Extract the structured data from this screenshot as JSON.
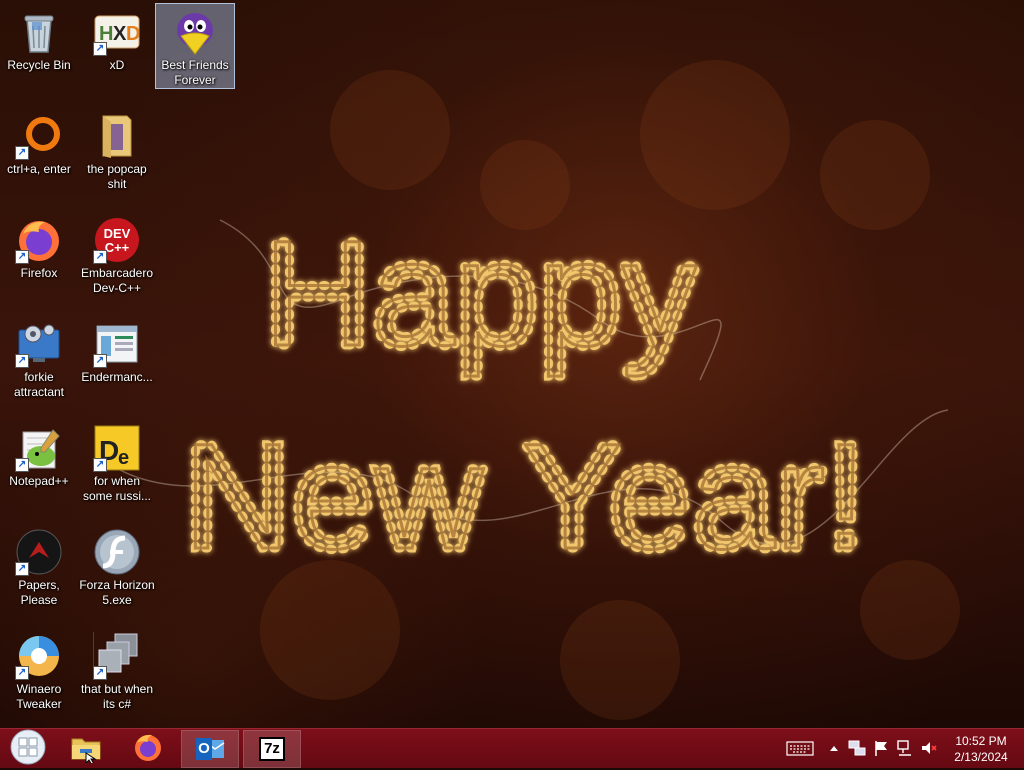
{
  "desktop": {
    "greeting": {
      "line1": "Happy",
      "line2": "New Year!"
    },
    "icons": [
      {
        "label": "Recycle Bin",
        "shortcut": false,
        "selected": false,
        "icon": "recycle-bin-icon"
      },
      {
        "label": "xD",
        "shortcut": true,
        "selected": false,
        "icon": "hxd-hex-editor-icon"
      },
      {
        "label": "Best Friends Forever",
        "shortcut": false,
        "selected": true,
        "icon": "purple-bird-icon"
      },
      {
        "label": "ctrl+a, enter",
        "shortcut": true,
        "selected": false,
        "icon": "orange-ring-icon"
      },
      {
        "label": "the popcap shit",
        "shortcut": false,
        "selected": false,
        "icon": "folder-icon"
      },
      {
        "label": "Firefox",
        "shortcut": true,
        "selected": false,
        "icon": "firefox-icon"
      },
      {
        "label": "Embarcadero Dev-C++",
        "shortcut": true,
        "selected": false,
        "icon": "dev-cpp-icon"
      },
      {
        "label": "forkie attractant",
        "shortcut": true,
        "selected": false,
        "icon": "settings-monitor-icon"
      },
      {
        "label": "Endermanc...",
        "shortcut": true,
        "selected": false,
        "icon": "window-app-icon"
      },
      {
        "label": "Notepad++",
        "shortcut": true,
        "selected": false,
        "icon": "notepad-plus-plus-icon"
      },
      {
        "label": "for when some russi...",
        "shortcut": true,
        "selected": false,
        "icon": "de-app-icon"
      },
      {
        "label": "Papers, Please",
        "shortcut": true,
        "selected": false,
        "icon": "papers-please-icon"
      },
      {
        "label": "Forza Horizon 5.exe",
        "shortcut": false,
        "selected": false,
        "icon": "flash-player-icon"
      },
      {
        "label": "Winaero Tweaker",
        "shortcut": true,
        "selected": false,
        "icon": "winaero-tweaker-icon"
      },
      {
        "label": "that but when its c#",
        "shortcut": true,
        "selected": false,
        "icon": "stacked-windows-icon"
      }
    ]
  },
  "taskbar": {
    "buttons": [
      {
        "name": "start-button",
        "icon": "windows-logo-icon",
        "active": false
      },
      {
        "name": "file-explorer-button",
        "icon": "file-explorer-icon",
        "active": false
      },
      {
        "name": "firefox-button",
        "icon": "firefox-icon",
        "active": false
      },
      {
        "name": "outlook-button",
        "icon": "outlook-icon",
        "active": true
      },
      {
        "name": "7zip-button",
        "icon": "7zip-icon",
        "active": true
      }
    ],
    "seven_zip_label": "7z",
    "outlook_letter": "O",
    "tray": {
      "icons": [
        "keyboard-icon",
        "chevron-up-icon",
        "network-share-icon",
        "flag-icon",
        "network-icon",
        "volume-muted-icon"
      ]
    },
    "clock": {
      "time": "10:52 PM",
      "date": "2/13/2024"
    }
  },
  "colors": {
    "taskbar": "#6f0c15",
    "label_text": "#ffffff",
    "selection": "#aac8f0"
  }
}
